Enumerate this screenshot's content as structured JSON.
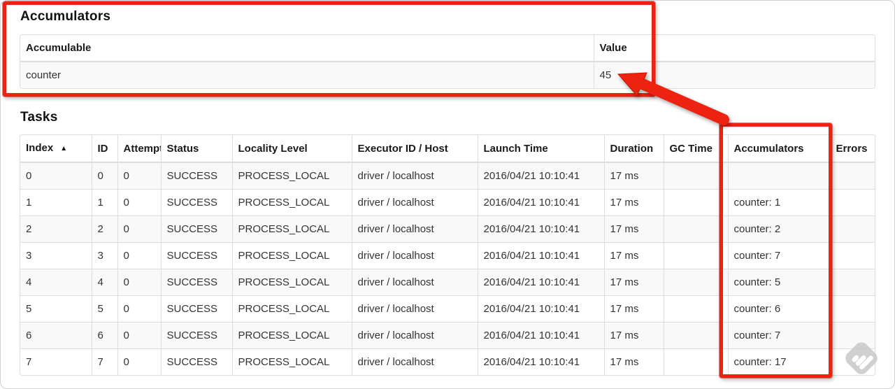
{
  "accumulators_section": {
    "heading": "Accumulators",
    "table": {
      "headers": [
        "Accumulable",
        "Value"
      ],
      "row": {
        "accumulable": "counter",
        "value": "45"
      }
    }
  },
  "tasks_section": {
    "heading": "Tasks",
    "table": {
      "sort_indicator": "▲",
      "columns": [
        {
          "key": "index",
          "label": "Index"
        },
        {
          "key": "id",
          "label": "ID"
        },
        {
          "key": "attempt",
          "label": "Attempt"
        },
        {
          "key": "status",
          "label": "Status"
        },
        {
          "key": "locality",
          "label": "Locality Level"
        },
        {
          "key": "executor",
          "label": "Executor ID / Host"
        },
        {
          "key": "launch",
          "label": "Launch Time"
        },
        {
          "key": "duration",
          "label": "Duration"
        },
        {
          "key": "gc_time",
          "label": "GC Time"
        },
        {
          "key": "accumulators",
          "label": "Accumulators"
        },
        {
          "key": "errors",
          "label": "Errors"
        }
      ],
      "rows": [
        {
          "index": "0",
          "id": "0",
          "attempt": "0",
          "status": "SUCCESS",
          "locality": "PROCESS_LOCAL",
          "executor": "driver / localhost",
          "launch": "2016/04/21 10:10:41",
          "duration": "17 ms",
          "gc_time": "",
          "accumulators": "",
          "errors": ""
        },
        {
          "index": "1",
          "id": "1",
          "attempt": "0",
          "status": "SUCCESS",
          "locality": "PROCESS_LOCAL",
          "executor": "driver / localhost",
          "launch": "2016/04/21 10:10:41",
          "duration": "17 ms",
          "gc_time": "",
          "accumulators": "counter: 1",
          "errors": ""
        },
        {
          "index": "2",
          "id": "2",
          "attempt": "0",
          "status": "SUCCESS",
          "locality": "PROCESS_LOCAL",
          "executor": "driver / localhost",
          "launch": "2016/04/21 10:10:41",
          "duration": "17 ms",
          "gc_time": "",
          "accumulators": "counter: 2",
          "errors": ""
        },
        {
          "index": "3",
          "id": "3",
          "attempt": "0",
          "status": "SUCCESS",
          "locality": "PROCESS_LOCAL",
          "executor": "driver / localhost",
          "launch": "2016/04/21 10:10:41",
          "duration": "17 ms",
          "gc_time": "",
          "accumulators": "counter: 7",
          "errors": ""
        },
        {
          "index": "4",
          "id": "4",
          "attempt": "0",
          "status": "SUCCESS",
          "locality": "PROCESS_LOCAL",
          "executor": "driver / localhost",
          "launch": "2016/04/21 10:10:41",
          "duration": "17 ms",
          "gc_time": "",
          "accumulators": "counter: 5",
          "errors": ""
        },
        {
          "index": "5",
          "id": "5",
          "attempt": "0",
          "status": "SUCCESS",
          "locality": "PROCESS_LOCAL",
          "executor": "driver / localhost",
          "launch": "2016/04/21 10:10:41",
          "duration": "17 ms",
          "gc_time": "",
          "accumulators": "counter: 6",
          "errors": ""
        },
        {
          "index": "6",
          "id": "6",
          "attempt": "0",
          "status": "SUCCESS",
          "locality": "PROCESS_LOCAL",
          "executor": "driver / localhost",
          "launch": "2016/04/21 10:10:41",
          "duration": "17 ms",
          "gc_time": "",
          "accumulators": "counter: 7",
          "errors": ""
        },
        {
          "index": "7",
          "id": "7",
          "attempt": "0",
          "status": "SUCCESS",
          "locality": "PROCESS_LOCAL",
          "executor": "driver / localhost",
          "launch": "2016/04/21 10:10:41",
          "duration": "17 ms",
          "gc_time": "",
          "accumulators": "counter: 17",
          "errors": ""
        }
      ]
    }
  },
  "annotations": {
    "highlight_color": "#ee2211"
  }
}
